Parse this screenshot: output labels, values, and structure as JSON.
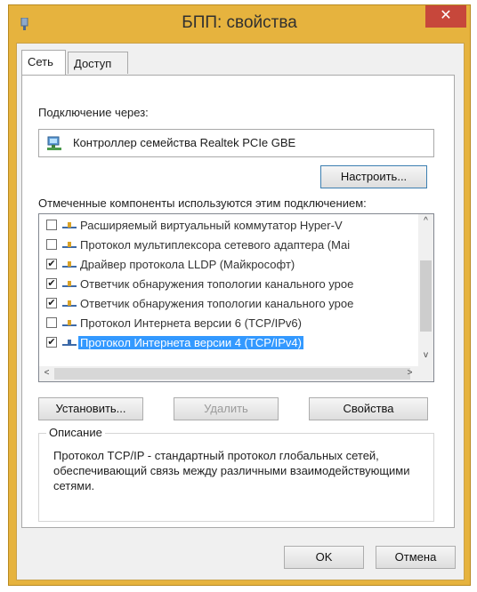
{
  "window": {
    "title": "БПП: свойства",
    "close_glyph": "✕"
  },
  "tabs": [
    {
      "label": "Сеть",
      "active": true
    },
    {
      "label": "Доступ",
      "active": false
    }
  ],
  "connect_via": {
    "label": "Подключение через:",
    "adapter_name": "Контроллер семейства Realtek PCIe GBE",
    "adapter_icon": "network-adapter-icon"
  },
  "configure_button": "Настроить...",
  "components": {
    "label": "Отмеченные компоненты используются этим подключением:",
    "items": [
      {
        "checked": false,
        "text": "Расширяемый виртуальный коммутатор Hyper-V",
        "selected": false
      },
      {
        "checked": false,
        "text": "Протокол мультиплексора сетевого адаптера (Mai",
        "selected": false
      },
      {
        "checked": true,
        "text": "Драйвер протокола LLDP (Майкрософт)",
        "selected": false
      },
      {
        "checked": true,
        "text": "Ответчик обнаружения топологии канального урое",
        "selected": false
      },
      {
        "checked": true,
        "text": "Ответчик обнаружения топологии канального урое",
        "selected": false
      },
      {
        "checked": false,
        "text": "Протокол Интернета версии 6 (TCP/IPv6)",
        "selected": false
      },
      {
        "checked": true,
        "text": "Протокол Интернета версии 4 (TCP/IPv4)",
        "selected": true
      }
    ],
    "scroll_up": "^",
    "scroll_down": "v",
    "scroll_left": "<",
    "scroll_right": ">"
  },
  "actions": {
    "install": "Установить...",
    "remove": "Удалить",
    "properties": "Свойства"
  },
  "description": {
    "legend": "Описание",
    "text": "Протокол TCP/IP - стандартный протокол глобальных сетей, обеспечивающий связь между различными взаимодействующими сетями."
  },
  "footer": {
    "ok": "OK",
    "cancel": "Отмена"
  },
  "colors": {
    "title_bar": "#e6b33e",
    "close_button": "#c7473b",
    "selection": "#3399ff"
  }
}
